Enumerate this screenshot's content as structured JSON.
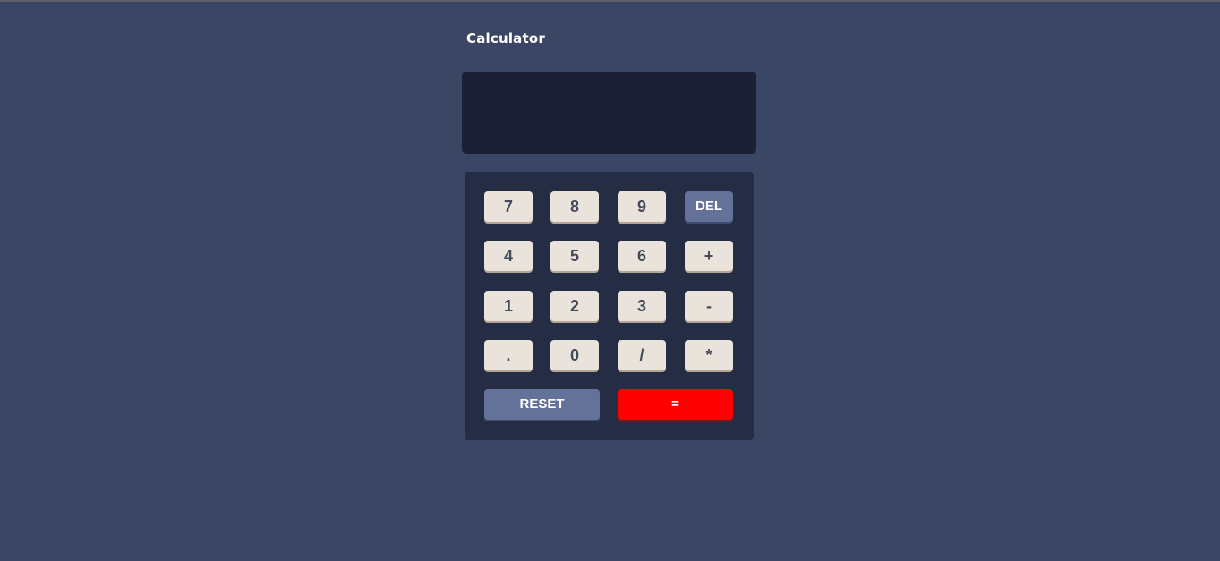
{
  "app": {
    "title": "Calculator"
  },
  "display": {
    "value": ""
  },
  "keys": {
    "seven": "7",
    "eight": "8",
    "nine": "9",
    "del": "DEL",
    "four": "4",
    "five": "5",
    "six": "6",
    "plus": "+",
    "one": "1",
    "two": "2",
    "three": "3",
    "minus": "-",
    "dot": ".",
    "zero": "0",
    "divide": "/",
    "multiply": "*",
    "reset": "RESET",
    "equals": "="
  },
  "colors": {
    "background": "#3b4664",
    "display": "#1b2035",
    "keypad": "#252d45",
    "key": "#eae3dc",
    "key_text": "#434a59",
    "function_key": "#647198",
    "equals_key": "#ff0000"
  }
}
